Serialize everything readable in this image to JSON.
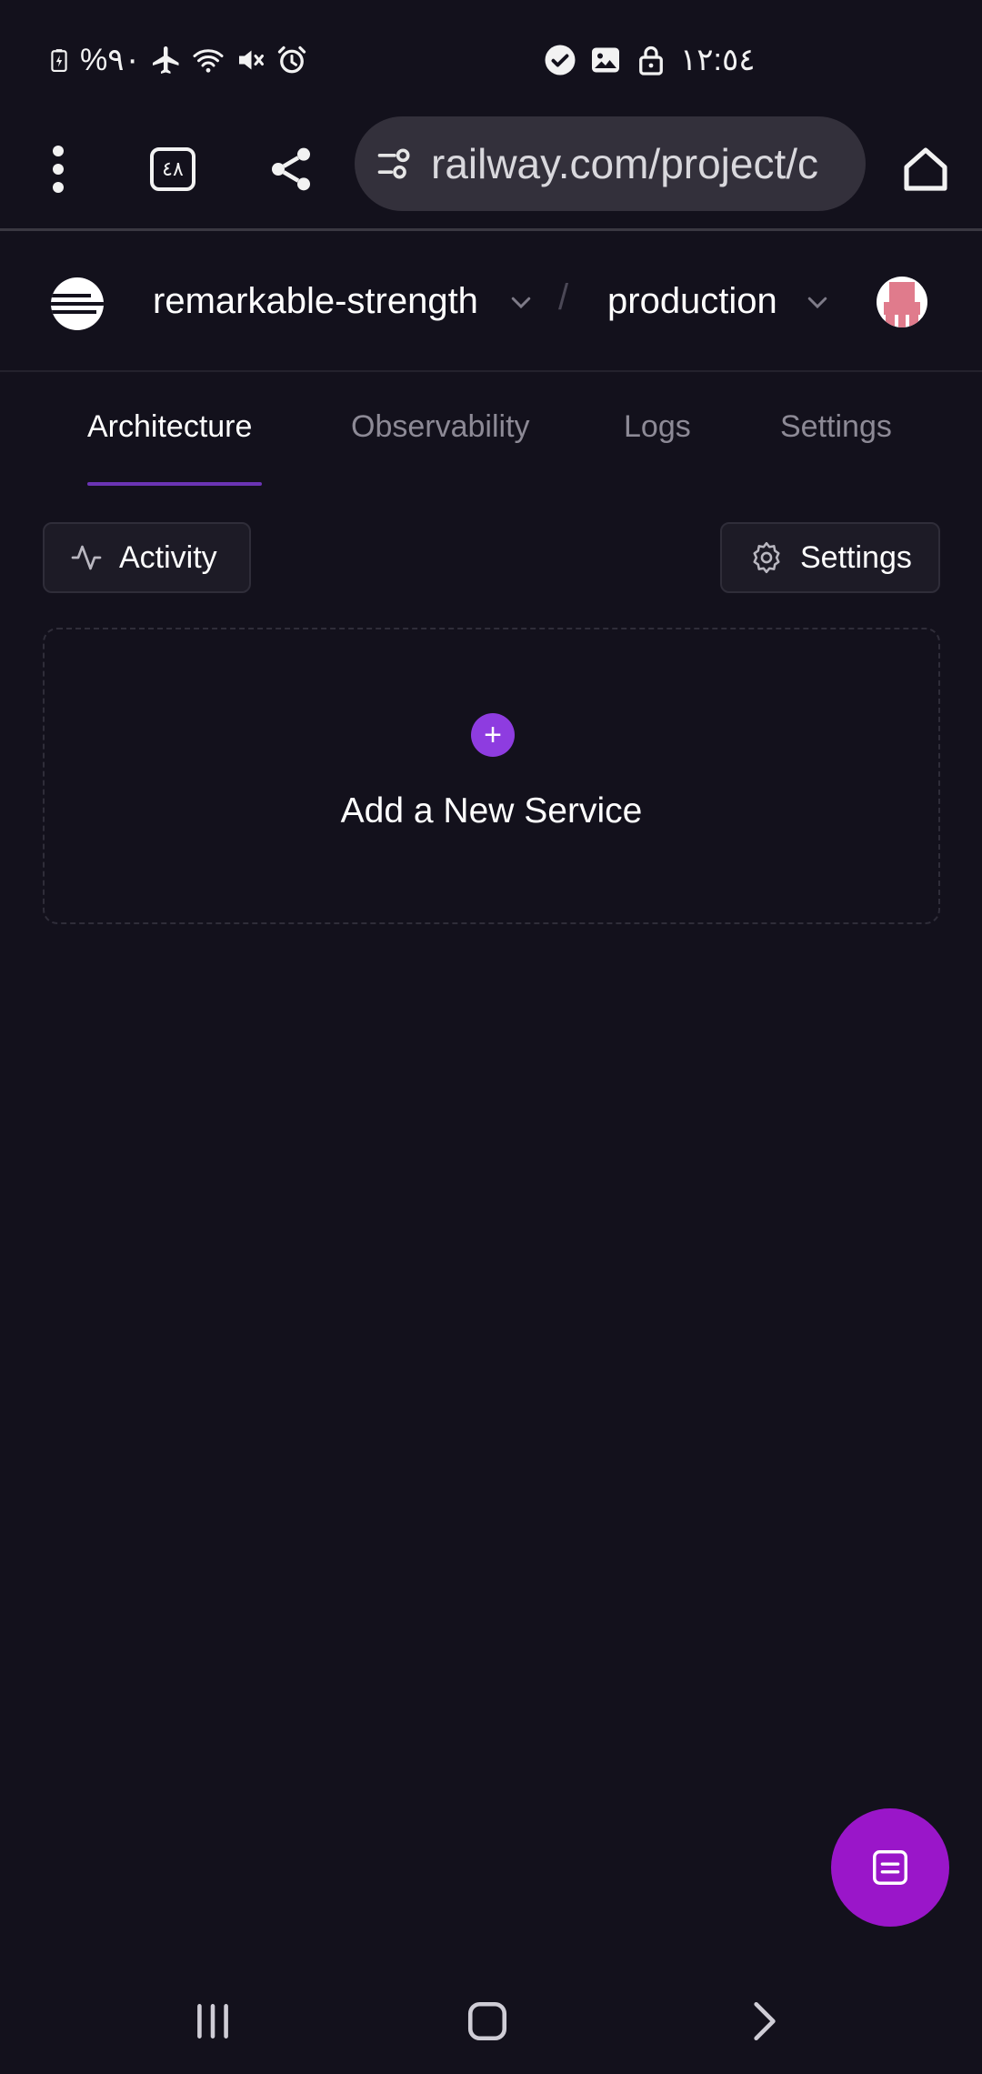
{
  "status_bar": {
    "battery_text": "%٩٠",
    "time": "١٢:٥٤",
    "icons_left": [
      "battery-charging-icon",
      "airplane-icon",
      "wifi-icon",
      "mute-icon",
      "alarm-icon"
    ],
    "icons_center": [
      "check-circle-icon",
      "image-icon",
      "lock-icon"
    ]
  },
  "browser": {
    "tab_count": "٤٨",
    "url": "railway.com/project/c"
  },
  "header": {
    "project_name": "remarkable-strength",
    "separator": "/",
    "environment": "production"
  },
  "tabs": [
    {
      "label": "Architecture",
      "active": true
    },
    {
      "label": "Observability",
      "active": false
    },
    {
      "label": "Logs",
      "active": false
    },
    {
      "label": "Settings",
      "active": false
    }
  ],
  "actions": {
    "activity_label": "Activity",
    "settings_label": "Settings"
  },
  "canvas": {
    "add_service_label": "Add a New Service",
    "plus_symbol": "+"
  },
  "colors": {
    "background": "#13111c",
    "accent_purple": "#8e3ce0",
    "fab": "#9a16c9",
    "tab_underline": "#6b34b5"
  }
}
